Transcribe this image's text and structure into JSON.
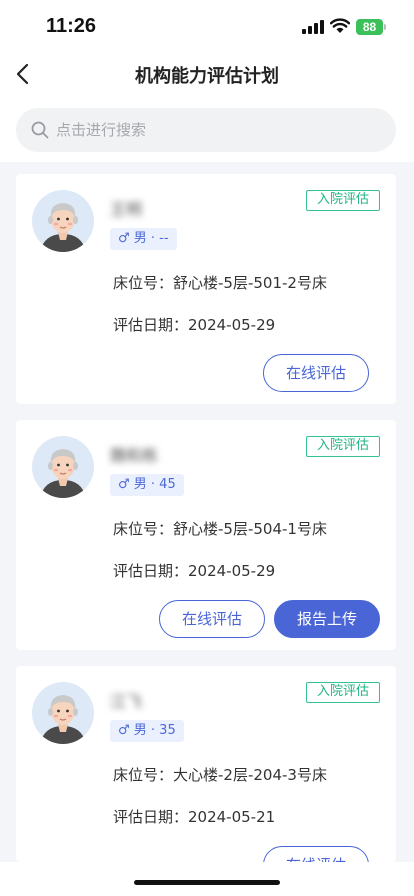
{
  "status_bar": {
    "time": "11:26",
    "battery": "88"
  },
  "header": {
    "title": "机构能力评估计划"
  },
  "search": {
    "placeholder": "点击进行搜索"
  },
  "colors": {
    "accent": "#4a66d6",
    "tag_green": "#22b585",
    "tag_bg": "#eaf0fd"
  },
  "cards": [
    {
      "name": "王明",
      "gender": "♂ 男 · --",
      "status": "入院评估",
      "bed": "床位号：舒心楼-5层-501-2号床",
      "date": "评估日期：2024-05-29",
      "buttons": [
        "在线评估"
      ]
    },
    {
      "name": "魏和栋",
      "gender": "♂ 男 · 45",
      "status": "入院评估",
      "bed": "床位号：舒心楼-5层-504-1号床",
      "date": "评估日期：2024-05-29",
      "buttons": [
        "在线评估",
        "报告上传"
      ]
    },
    {
      "name": "江飞",
      "gender": "♂ 男 · 35",
      "status": "入院评估",
      "bed": "床位号：大心楼-2层-204-3号床",
      "date": "评估日期：2024-05-21",
      "buttons": [
        "在线评估"
      ]
    }
  ]
}
